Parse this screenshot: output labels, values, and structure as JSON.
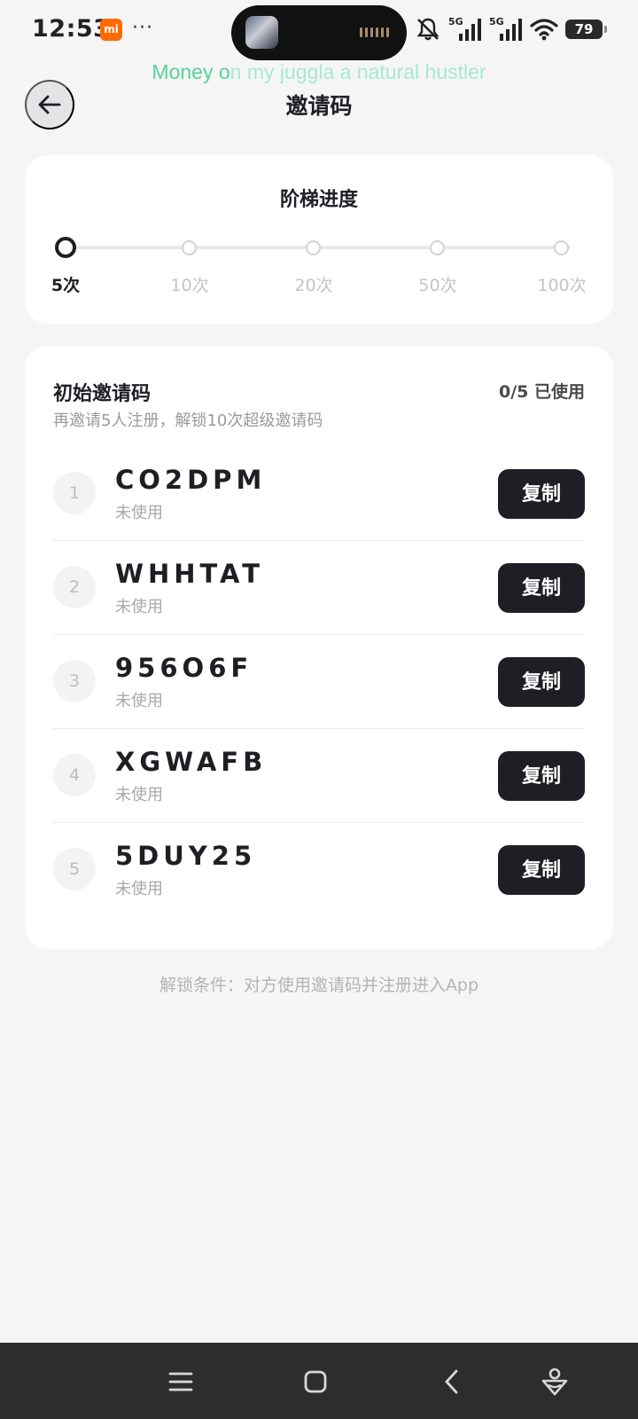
{
  "status_bar": {
    "time": "12:53",
    "mi_badge": "mi",
    "more": "···",
    "battery": "79",
    "network_1": "5G",
    "network_2": "5G"
  },
  "lyric": {
    "highlighted": "Money o",
    "rest": "n my juggla a natural hustler"
  },
  "header": {
    "title": "邀请码"
  },
  "progress": {
    "title": "阶梯进度",
    "current_step": 0,
    "steps": [
      "5次",
      "10次",
      "20次",
      "50次",
      "100次"
    ]
  },
  "codes": {
    "title": "初始邀请码",
    "usage": "0/5 已使用",
    "subtitle": "再邀请5人注册，解锁10次超级邀请码",
    "copy_label": "复制",
    "items": [
      {
        "index": "1",
        "code": "CO2DPM",
        "status": "未使用"
      },
      {
        "index": "2",
        "code": "WHHTAT",
        "status": "未使用"
      },
      {
        "index": "3",
        "code": "956O6F",
        "status": "未使用"
      },
      {
        "index": "4",
        "code": "XGWAFB",
        "status": "未使用"
      },
      {
        "index": "5",
        "code": "5DUY25",
        "status": "未使用"
      }
    ]
  },
  "footnote": "解锁条件：对方使用邀请码并注册进入App",
  "colors": {
    "accent_dark": "#1e1e24",
    "lyric_green": "#58d29a",
    "background": "#f5f5f5"
  },
  "icons": {
    "back": "arrow-left-icon",
    "nav_menu": "menu-icon",
    "nav_home": "home-square-icon",
    "nav_back": "chevron-left-icon",
    "nav_assistant": "assistant-icon"
  }
}
